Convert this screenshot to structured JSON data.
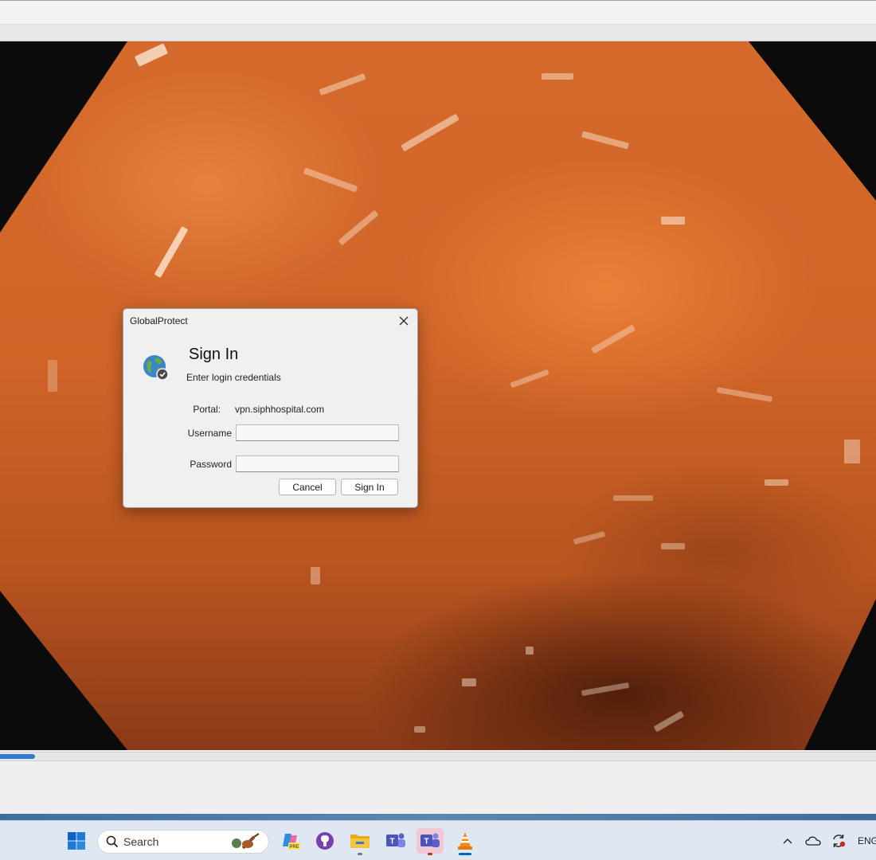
{
  "dialog": {
    "title": "GlobalProtect",
    "heading": "Sign In",
    "subheading": "Enter login credentials",
    "portal_label": "Portal:",
    "portal_value": "vpn.siphhospital.com",
    "username_label": "Username",
    "username_value": "",
    "password_label": "Password",
    "password_value": "",
    "cancel_label": "Cancel",
    "signin_label": "Sign In",
    "icons": [
      "globe-shield-icon",
      "close-icon"
    ]
  },
  "player": {
    "progress_fraction": 0.04,
    "accent_color": "#2f7bd2"
  },
  "taskbar": {
    "search_placeholder": "Search",
    "language": "ENG",
    "apps": [
      "start-icon",
      "copilot-pre-icon",
      "github-desktop-icon",
      "file-explorer-icon",
      "teams-classic-icon",
      "teams-icon",
      "vlc-icon"
    ],
    "tray_icons": [
      "chevron-up-icon",
      "onedrive-icon",
      "sync-icon"
    ]
  }
}
